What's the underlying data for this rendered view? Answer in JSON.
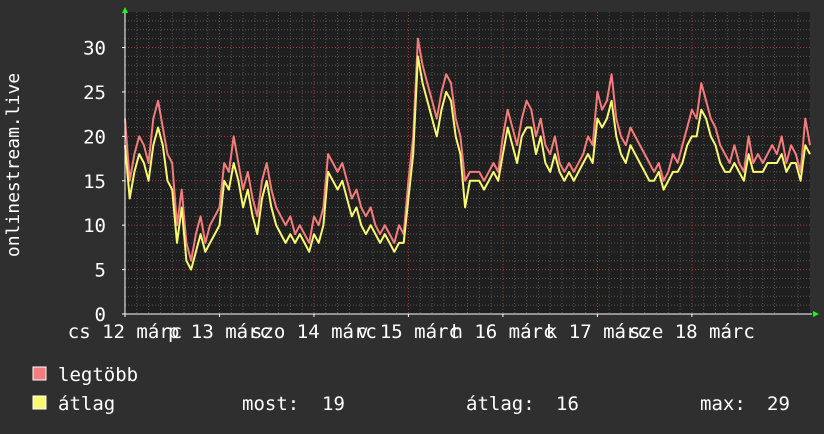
{
  "colors": {
    "background": "#2f2f2f",
    "plot_background": "#1f1f1f",
    "grid_minor": "#555555",
    "grid_major": "#a83a3a",
    "axis": "#ffffff",
    "legtobb": "#f47c7c",
    "atlag": "#f8f871",
    "arrow": "#14ff14"
  },
  "chart_data": {
    "type": "line",
    "ylabel": "onlinestream.live",
    "ylim": [
      0,
      34
    ],
    "yticks": [
      0,
      5,
      10,
      15,
      20,
      25,
      30
    ],
    "xlim": [
      0,
      7.25
    ],
    "xticks": [
      {
        "x": 0.0,
        "label": "cs 12 márc"
      },
      {
        "x": 1.0,
        "label": "p 13 márc"
      },
      {
        "x": 2.0,
        "label": "szo 14 márc"
      },
      {
        "x": 3.0,
        "label": "v 15 márc"
      },
      {
        "x": 4.0,
        "label": "h 16 márc"
      },
      {
        "x": 5.0,
        "label": "k 17 márc"
      },
      {
        "x": 6.0,
        "label": "sze 18 márc"
      }
    ],
    "grid": true,
    "series": [
      {
        "name": "legtöbb",
        "color": "#f47c7c",
        "points": [
          [
            0.0,
            22
          ],
          [
            0.05,
            15
          ],
          [
            0.1,
            18
          ],
          [
            0.15,
            20
          ],
          [
            0.2,
            19
          ],
          [
            0.25,
            17
          ],
          [
            0.3,
            22
          ],
          [
            0.35,
            24
          ],
          [
            0.4,
            21
          ],
          [
            0.45,
            18
          ],
          [
            0.5,
            17
          ],
          [
            0.55,
            10
          ],
          [
            0.6,
            14
          ],
          [
            0.65,
            8
          ],
          [
            0.7,
            6
          ],
          [
            0.75,
            9
          ],
          [
            0.8,
            11
          ],
          [
            0.85,
            8
          ],
          [
            0.9,
            10
          ],
          [
            0.95,
            11
          ],
          [
            1.0,
            12
          ],
          [
            1.05,
            17
          ],
          [
            1.1,
            16
          ],
          [
            1.15,
            20
          ],
          [
            1.2,
            17
          ],
          [
            1.25,
            14
          ],
          [
            1.3,
            16
          ],
          [
            1.35,
            13
          ],
          [
            1.4,
            11
          ],
          [
            1.45,
            15
          ],
          [
            1.5,
            17
          ],
          [
            1.55,
            14
          ],
          [
            1.6,
            12
          ],
          [
            1.65,
            11
          ],
          [
            1.7,
            10
          ],
          [
            1.75,
            11
          ],
          [
            1.8,
            9
          ],
          [
            1.85,
            10
          ],
          [
            1.9,
            9
          ],
          [
            1.95,
            8
          ],
          [
            2.0,
            11
          ],
          [
            2.05,
            10
          ],
          [
            2.1,
            12
          ],
          [
            2.15,
            18
          ],
          [
            2.2,
            17
          ],
          [
            2.25,
            16
          ],
          [
            2.3,
            17
          ],
          [
            2.35,
            15
          ],
          [
            2.4,
            13
          ],
          [
            2.45,
            14
          ],
          [
            2.5,
            12
          ],
          [
            2.55,
            11
          ],
          [
            2.6,
            12
          ],
          [
            2.65,
            10
          ],
          [
            2.7,
            9
          ],
          [
            2.75,
            10
          ],
          [
            2.8,
            9
          ],
          [
            2.85,
            8
          ],
          [
            2.9,
            10
          ],
          [
            2.95,
            9
          ],
          [
            3.0,
            15
          ],
          [
            3.05,
            20
          ],
          [
            3.1,
            31
          ],
          [
            3.15,
            28
          ],
          [
            3.2,
            26
          ],
          [
            3.25,
            24
          ],
          [
            3.3,
            22
          ],
          [
            3.35,
            25
          ],
          [
            3.4,
            27
          ],
          [
            3.45,
            26
          ],
          [
            3.5,
            22
          ],
          [
            3.55,
            20
          ],
          [
            3.6,
            15
          ],
          [
            3.65,
            16
          ],
          [
            3.7,
            16
          ],
          [
            3.75,
            16
          ],
          [
            3.8,
            15
          ],
          [
            3.85,
            16
          ],
          [
            3.9,
            17
          ],
          [
            3.95,
            16
          ],
          [
            4.0,
            20
          ],
          [
            4.05,
            23
          ],
          [
            4.1,
            21
          ],
          [
            4.15,
            19
          ],
          [
            4.2,
            22
          ],
          [
            4.25,
            24
          ],
          [
            4.3,
            23
          ],
          [
            4.35,
            20
          ],
          [
            4.4,
            22
          ],
          [
            4.45,
            19
          ],
          [
            4.5,
            18
          ],
          [
            4.55,
            20
          ],
          [
            4.6,
            17
          ],
          [
            4.65,
            16
          ],
          [
            4.7,
            17
          ],
          [
            4.75,
            16
          ],
          [
            4.8,
            17
          ],
          [
            4.85,
            18
          ],
          [
            4.9,
            20
          ],
          [
            4.95,
            19
          ],
          [
            5.0,
            25
          ],
          [
            5.05,
            23
          ],
          [
            5.1,
            24
          ],
          [
            5.15,
            27
          ],
          [
            5.2,
            22
          ],
          [
            5.25,
            20
          ],
          [
            5.3,
            19
          ],
          [
            5.35,
            21
          ],
          [
            5.4,
            20
          ],
          [
            5.45,
            19
          ],
          [
            5.5,
            18
          ],
          [
            5.55,
            17
          ],
          [
            5.6,
            16
          ],
          [
            5.65,
            17
          ],
          [
            5.7,
            15
          ],
          [
            5.75,
            16
          ],
          [
            5.8,
            18
          ],
          [
            5.85,
            17
          ],
          [
            5.9,
            19
          ],
          [
            5.95,
            21
          ],
          [
            6.0,
            23
          ],
          [
            6.05,
            22
          ],
          [
            6.1,
            26
          ],
          [
            6.15,
            24
          ],
          [
            6.2,
            22
          ],
          [
            6.25,
            21
          ],
          [
            6.3,
            19
          ],
          [
            6.35,
            18
          ],
          [
            6.4,
            17
          ],
          [
            6.45,
            19
          ],
          [
            6.5,
            17
          ],
          [
            6.55,
            16
          ],
          [
            6.6,
            20
          ],
          [
            6.65,
            17
          ],
          [
            6.7,
            18
          ],
          [
            6.75,
            17
          ],
          [
            6.8,
            18
          ],
          [
            6.85,
            19
          ],
          [
            6.9,
            18
          ],
          [
            6.95,
            20
          ],
          [
            7.0,
            17
          ],
          [
            7.05,
            19
          ],
          [
            7.1,
            18
          ],
          [
            7.15,
            16
          ],
          [
            7.2,
            22
          ],
          [
            7.25,
            19
          ]
        ]
      },
      {
        "name": "átlag",
        "color": "#f8f871",
        "points": [
          [
            0.0,
            19
          ],
          [
            0.05,
            13
          ],
          [
            0.1,
            16
          ],
          [
            0.15,
            18
          ],
          [
            0.2,
            17
          ],
          [
            0.25,
            15
          ],
          [
            0.3,
            19
          ],
          [
            0.35,
            21
          ],
          [
            0.4,
            19
          ],
          [
            0.45,
            15
          ],
          [
            0.5,
            14
          ],
          [
            0.55,
            8
          ],
          [
            0.6,
            12
          ],
          [
            0.65,
            6
          ],
          [
            0.7,
            5
          ],
          [
            0.75,
            7
          ],
          [
            0.8,
            9
          ],
          [
            0.85,
            7
          ],
          [
            0.9,
            8
          ],
          [
            0.95,
            9
          ],
          [
            1.0,
            10
          ],
          [
            1.05,
            15
          ],
          [
            1.1,
            14
          ],
          [
            1.15,
            17
          ],
          [
            1.2,
            15
          ],
          [
            1.25,
            12
          ],
          [
            1.3,
            14
          ],
          [
            1.35,
            11
          ],
          [
            1.4,
            9
          ],
          [
            1.45,
            13
          ],
          [
            1.5,
            15
          ],
          [
            1.55,
            12
          ],
          [
            1.6,
            10
          ],
          [
            1.65,
            9
          ],
          [
            1.7,
            8
          ],
          [
            1.75,
            9
          ],
          [
            1.8,
            8
          ],
          [
            1.85,
            9
          ],
          [
            1.9,
            8
          ],
          [
            1.95,
            7
          ],
          [
            2.0,
            9
          ],
          [
            2.05,
            8
          ],
          [
            2.1,
            10
          ],
          [
            2.15,
            16
          ],
          [
            2.2,
            15
          ],
          [
            2.25,
            14
          ],
          [
            2.3,
            15
          ],
          [
            2.35,
            13
          ],
          [
            2.4,
            11
          ],
          [
            2.45,
            12
          ],
          [
            2.5,
            10
          ],
          [
            2.55,
            9
          ],
          [
            2.6,
            10
          ],
          [
            2.65,
            9
          ],
          [
            2.7,
            8
          ],
          [
            2.75,
            9
          ],
          [
            2.8,
            8
          ],
          [
            2.85,
            7
          ],
          [
            2.9,
            8
          ],
          [
            2.95,
            8
          ],
          [
            3.0,
            13
          ],
          [
            3.05,
            18
          ],
          [
            3.1,
            29
          ],
          [
            3.15,
            26
          ],
          [
            3.2,
            24
          ],
          [
            3.25,
            22
          ],
          [
            3.3,
            20
          ],
          [
            3.35,
            23
          ],
          [
            3.4,
            25
          ],
          [
            3.45,
            24
          ],
          [
            3.5,
            20
          ],
          [
            3.55,
            18
          ],
          [
            3.6,
            12
          ],
          [
            3.65,
            15
          ],
          [
            3.7,
            15
          ],
          [
            3.75,
            15
          ],
          [
            3.8,
            14
          ],
          [
            3.85,
            15
          ],
          [
            3.9,
            16
          ],
          [
            3.95,
            15
          ],
          [
            4.0,
            18
          ],
          [
            4.05,
            21
          ],
          [
            4.1,
            19
          ],
          [
            4.15,
            17
          ],
          [
            4.2,
            20
          ],
          [
            4.25,
            21
          ],
          [
            4.3,
            21
          ],
          [
            4.35,
            18
          ],
          [
            4.4,
            20
          ],
          [
            4.45,
            17
          ],
          [
            4.5,
            16
          ],
          [
            4.55,
            18
          ],
          [
            4.6,
            16
          ],
          [
            4.65,
            15
          ],
          [
            4.7,
            16
          ],
          [
            4.75,
            15
          ],
          [
            4.8,
            16
          ],
          [
            4.85,
            17
          ],
          [
            4.9,
            18
          ],
          [
            4.95,
            17
          ],
          [
            5.0,
            22
          ],
          [
            5.05,
            21
          ],
          [
            5.1,
            22
          ],
          [
            5.15,
            24
          ],
          [
            5.2,
            20
          ],
          [
            5.25,
            18
          ],
          [
            5.3,
            17
          ],
          [
            5.35,
            19
          ],
          [
            5.4,
            18
          ],
          [
            5.45,
            17
          ],
          [
            5.5,
            16
          ],
          [
            5.55,
            15
          ],
          [
            5.6,
            15
          ],
          [
            5.65,
            16
          ],
          [
            5.7,
            14
          ],
          [
            5.75,
            15
          ],
          [
            5.8,
            16
          ],
          [
            5.85,
            16
          ],
          [
            5.9,
            17
          ],
          [
            5.95,
            19
          ],
          [
            6.0,
            20
          ],
          [
            6.05,
            20
          ],
          [
            6.1,
            23
          ],
          [
            6.15,
            22
          ],
          [
            6.2,
            20
          ],
          [
            6.25,
            19
          ],
          [
            6.3,
            17
          ],
          [
            6.35,
            16
          ],
          [
            6.4,
            16
          ],
          [
            6.45,
            17
          ],
          [
            6.5,
            16
          ],
          [
            6.55,
            15
          ],
          [
            6.6,
            18
          ],
          [
            6.65,
            16
          ],
          [
            6.7,
            16
          ],
          [
            6.75,
            16
          ],
          [
            6.8,
            17
          ],
          [
            6.85,
            17
          ],
          [
            6.9,
            17
          ],
          [
            6.95,
            18
          ],
          [
            7.0,
            16
          ],
          [
            7.05,
            17
          ],
          [
            7.1,
            17
          ],
          [
            7.15,
            15
          ],
          [
            7.2,
            19
          ],
          [
            7.25,
            18
          ]
        ]
      }
    ]
  },
  "legend": {
    "items": [
      {
        "label": "legtöbb",
        "color": "#f47c7c"
      },
      {
        "label": "átlag",
        "color": "#f8f871"
      }
    ],
    "stats": {
      "now_label": "most:",
      "now_value": "19",
      "avg_label": "átlag:",
      "avg_value": "16",
      "max_label": "max:",
      "max_value": "29"
    }
  }
}
